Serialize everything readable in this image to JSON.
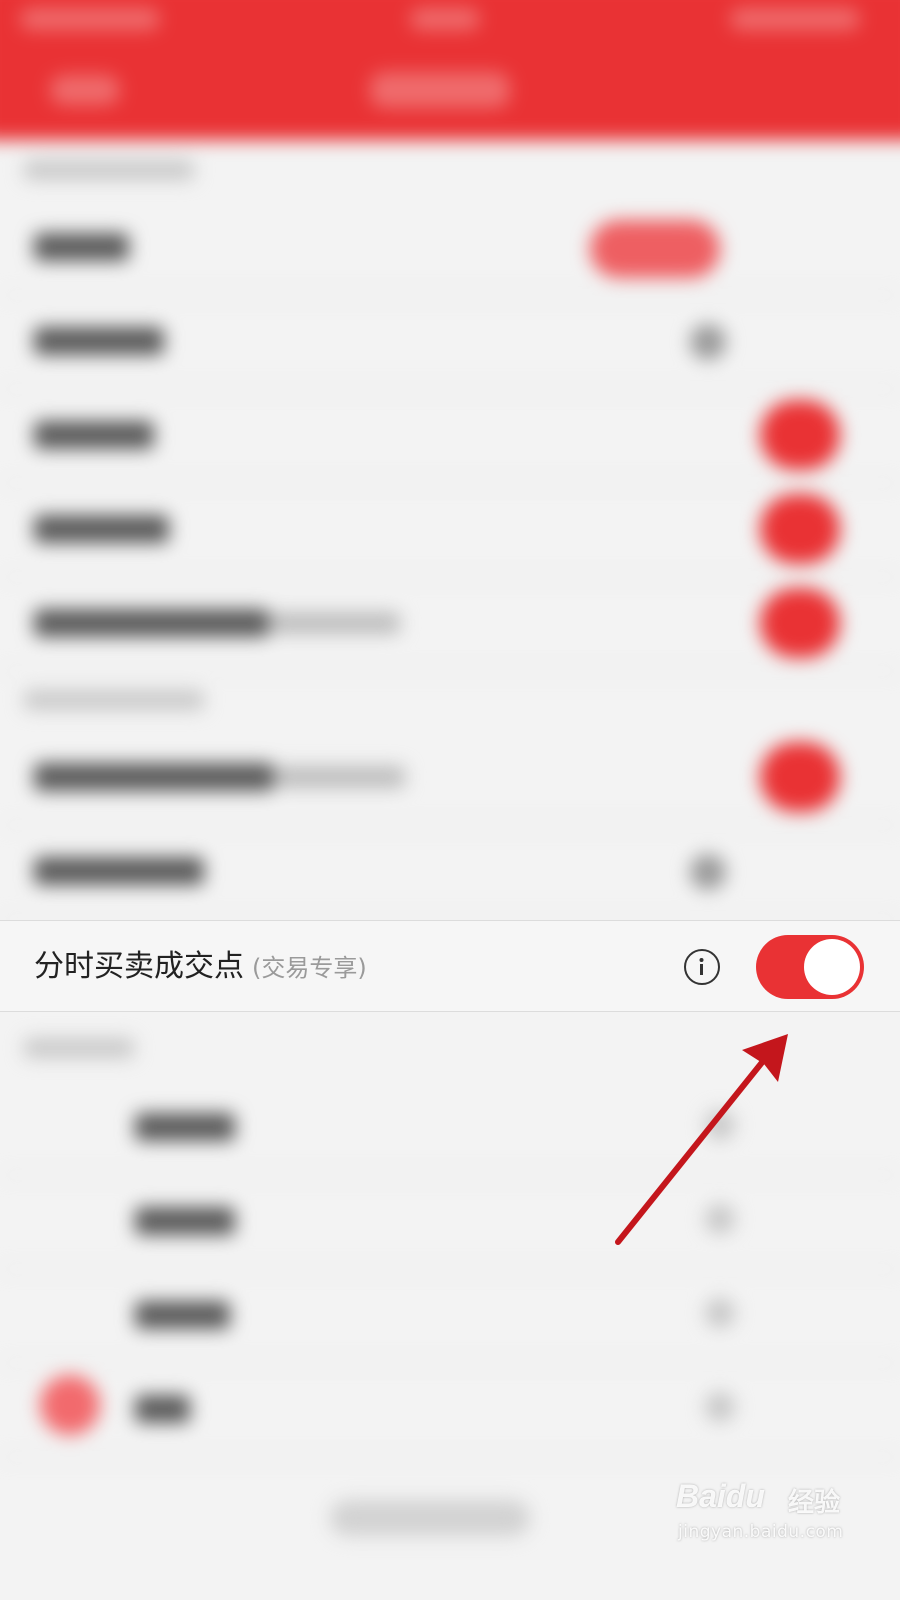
{
  "setting_row": {
    "label": "分时买卖成交点",
    "sublabel": "(交易专享)",
    "info_icon": "info-circle-icon",
    "toggle_state": "on",
    "toggle_color": "#e93234"
  },
  "annotation": {
    "arrow_color": "#c4161c"
  },
  "watermark": {
    "brand": "Baidu",
    "brand_cn": "经验",
    "url": "jingyan.baidu.com"
  },
  "colors": {
    "header": "#e93234",
    "background": "#f3f3f3"
  }
}
